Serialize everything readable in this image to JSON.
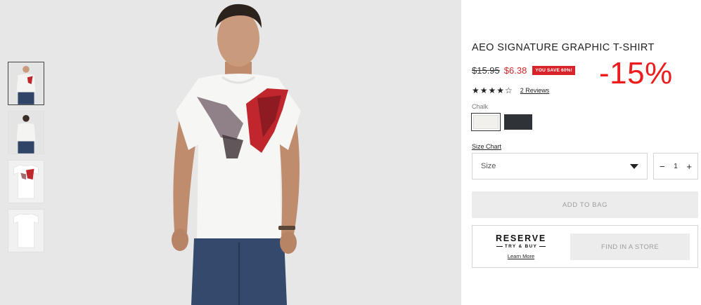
{
  "product": {
    "title": "AEO SIGNATURE GRAPHIC T-SHIRT",
    "price_original": "$15.95",
    "price_sale": "$6.38",
    "save_badge": "YOU SAVE 60%!",
    "promo_discount": "-15%",
    "rating_stars": "★★★★☆",
    "rating_value": 4,
    "reviews_link": "2 Reviews"
  },
  "color": {
    "label": "Chalk",
    "swatches": [
      "chalk",
      "dark-heather"
    ],
    "selected": "chalk",
    "colors": {
      "chalk": "#f1f0ec",
      "dark": "#2f3237"
    }
  },
  "size": {
    "chart_link": "Size Chart",
    "select_label": "Size"
  },
  "quantity": {
    "minus": "−",
    "value": "1",
    "plus": "+"
  },
  "actions": {
    "add_to_bag": "ADD TO BAG",
    "reserve_title": "RESERVE",
    "reserve_subtitle": "TRY & BUY",
    "learn_more": "Learn More",
    "find_in_store": "FIND IN A STORE"
  },
  "gallery": {
    "thumbnails": [
      "front-model",
      "back-model",
      "flat-front",
      "flat-back"
    ],
    "active_index": 0
  },
  "theme": {
    "sale_red": "#d12a2a",
    "promo_red": "#ee1c1c",
    "graphic_red": "#c0272d"
  }
}
